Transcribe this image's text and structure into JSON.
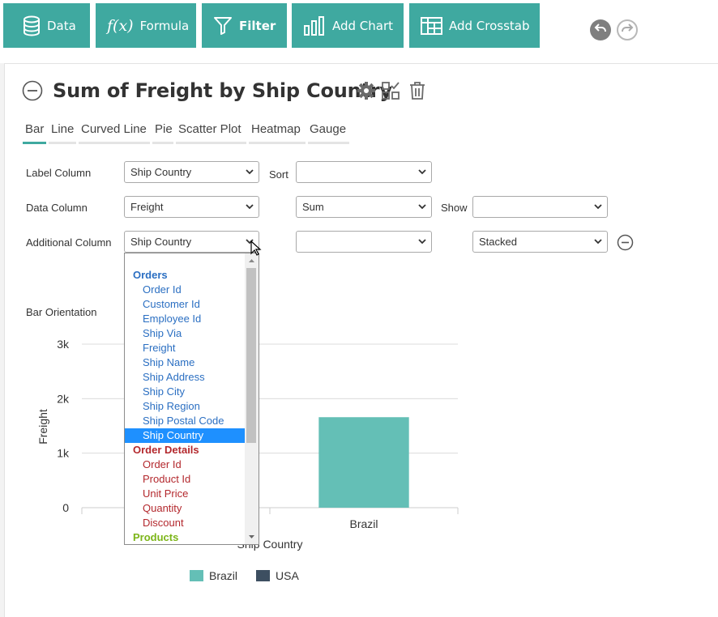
{
  "toolbar": {
    "data_label": "Data",
    "formula_label": "Formula",
    "filter_label": "Filter",
    "add_chart_label": "Add Chart",
    "add_crosstab_label": "Add Crosstab"
  },
  "header": {
    "title": "Sum of Freight by Ship Country"
  },
  "tabs": [
    {
      "label": "Bar",
      "active": true
    },
    {
      "label": "Line"
    },
    {
      "label": "Curved Line"
    },
    {
      "label": "Pie"
    },
    {
      "label": "Scatter Plot"
    },
    {
      "label": "Heatmap"
    },
    {
      "label": "Gauge"
    }
  ],
  "form": {
    "label_column": {
      "label": "Label Column",
      "value": "Ship Country"
    },
    "sort": {
      "label": "Sort",
      "value": ""
    },
    "data_column": {
      "label": "Data Column",
      "value": "Freight"
    },
    "aggregate": {
      "value": "Sum"
    },
    "show": {
      "label": "Show",
      "value": ""
    },
    "additional_column": {
      "label": "Additional Column",
      "value": "Ship Country"
    },
    "additional_extra": {
      "value": ""
    },
    "stacking": {
      "value": "Stacked"
    },
    "bar_orientation_label": "Bar Orientation"
  },
  "dropdown": {
    "groups": [
      {
        "name": "Orders",
        "color": "#2b6fc2",
        "items": [
          "Order Id",
          "Customer Id",
          "Employee Id",
          "Ship Via",
          "Freight",
          "Ship Name",
          "Ship Address",
          "Ship City",
          "Ship Region",
          "Ship Postal Code",
          "Ship Country"
        ]
      },
      {
        "name": "Order Details",
        "color": "#b3282d",
        "items": [
          "Order Id",
          "Product Id",
          "Unit Price",
          "Quantity",
          "Discount"
        ]
      },
      {
        "name": "Products",
        "color": "#7cb518",
        "items": []
      }
    ],
    "selected": "Ship Country"
  },
  "chart_data": {
    "type": "bar",
    "categories": [
      "",
      "Brazil"
    ],
    "series": [
      {
        "name": "Brazil",
        "values": [
          null,
          1660
        ],
        "color": "#64bfb6"
      },
      {
        "name": "USA",
        "values": [
          null,
          null
        ],
        "color": "#3d4f61"
      }
    ],
    "ylabel": "Freight",
    "xlabel": "Ship Country",
    "ylim": [
      0,
      3000
    ],
    "yticks": [
      "0",
      "1k",
      "2k",
      "3k"
    ],
    "yticks_values": [
      0,
      1000,
      2000,
      3000
    ],
    "legend_position": "bottom"
  }
}
